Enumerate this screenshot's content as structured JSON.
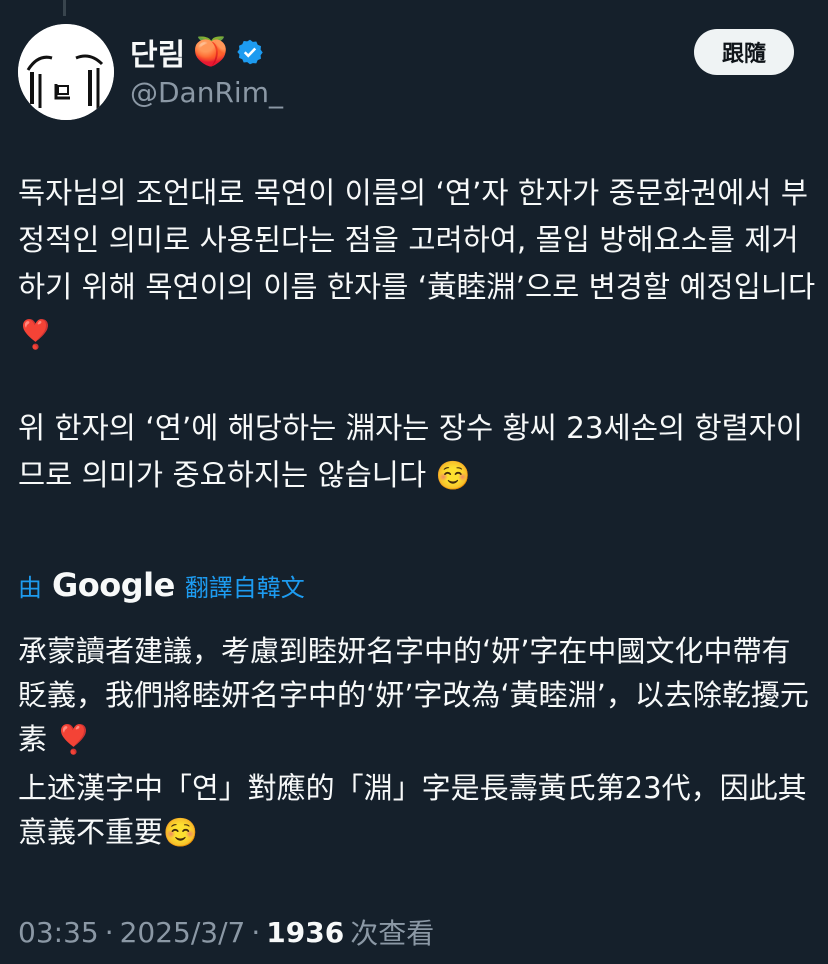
{
  "author": {
    "display_name": "단림",
    "name_emoji": "🍑",
    "handle": "@DanRim_",
    "verified_icon": "verified-badge-icon",
    "verified_color": "#1d9bf0"
  },
  "follow_button": {
    "label": "跟隨"
  },
  "tweet": {
    "paragraph1": "독자님의 조언대로 목연이 이름의 ‘연’자 한자가 중문화권에서 부정적인 의미로 사용된다는 점을 고려하여, 몰입 방해요소를 제거하기 위해 목연이의 이름 한자를 ‘黃睦淵’으로 변경할 예정입니다",
    "paragraph1_emoji": "❣️",
    "paragraph2": "위 한자의 ‘연’에 해당하는 淵자는 장수 황씨 23세손의 항렬자이므로 의미가 중요하지는 않습니다",
    "paragraph2_emoji": "☺️"
  },
  "translation": {
    "prefix": "由",
    "google": "Google",
    "suffix": "翻譯自韓文",
    "paragraph1": "承蒙讀者建議，考慮到睦妍名字中的‘妍’字在中國文化中帶有貶義，我們將睦妍名字中的‘妍’字改為‘黃睦淵’，以去除乾擾元素",
    "paragraph1_emoji": "❣️",
    "paragraph2": "上述漢字中「연」對應的「淵」字是長壽黃氏第23代，因此其意義不重要",
    "paragraph2_emoji": "☺️"
  },
  "meta": {
    "time": "03:35",
    "separator": "·",
    "date": "2025/3/7",
    "views_count": "1936",
    "views_label": "次查看"
  }
}
